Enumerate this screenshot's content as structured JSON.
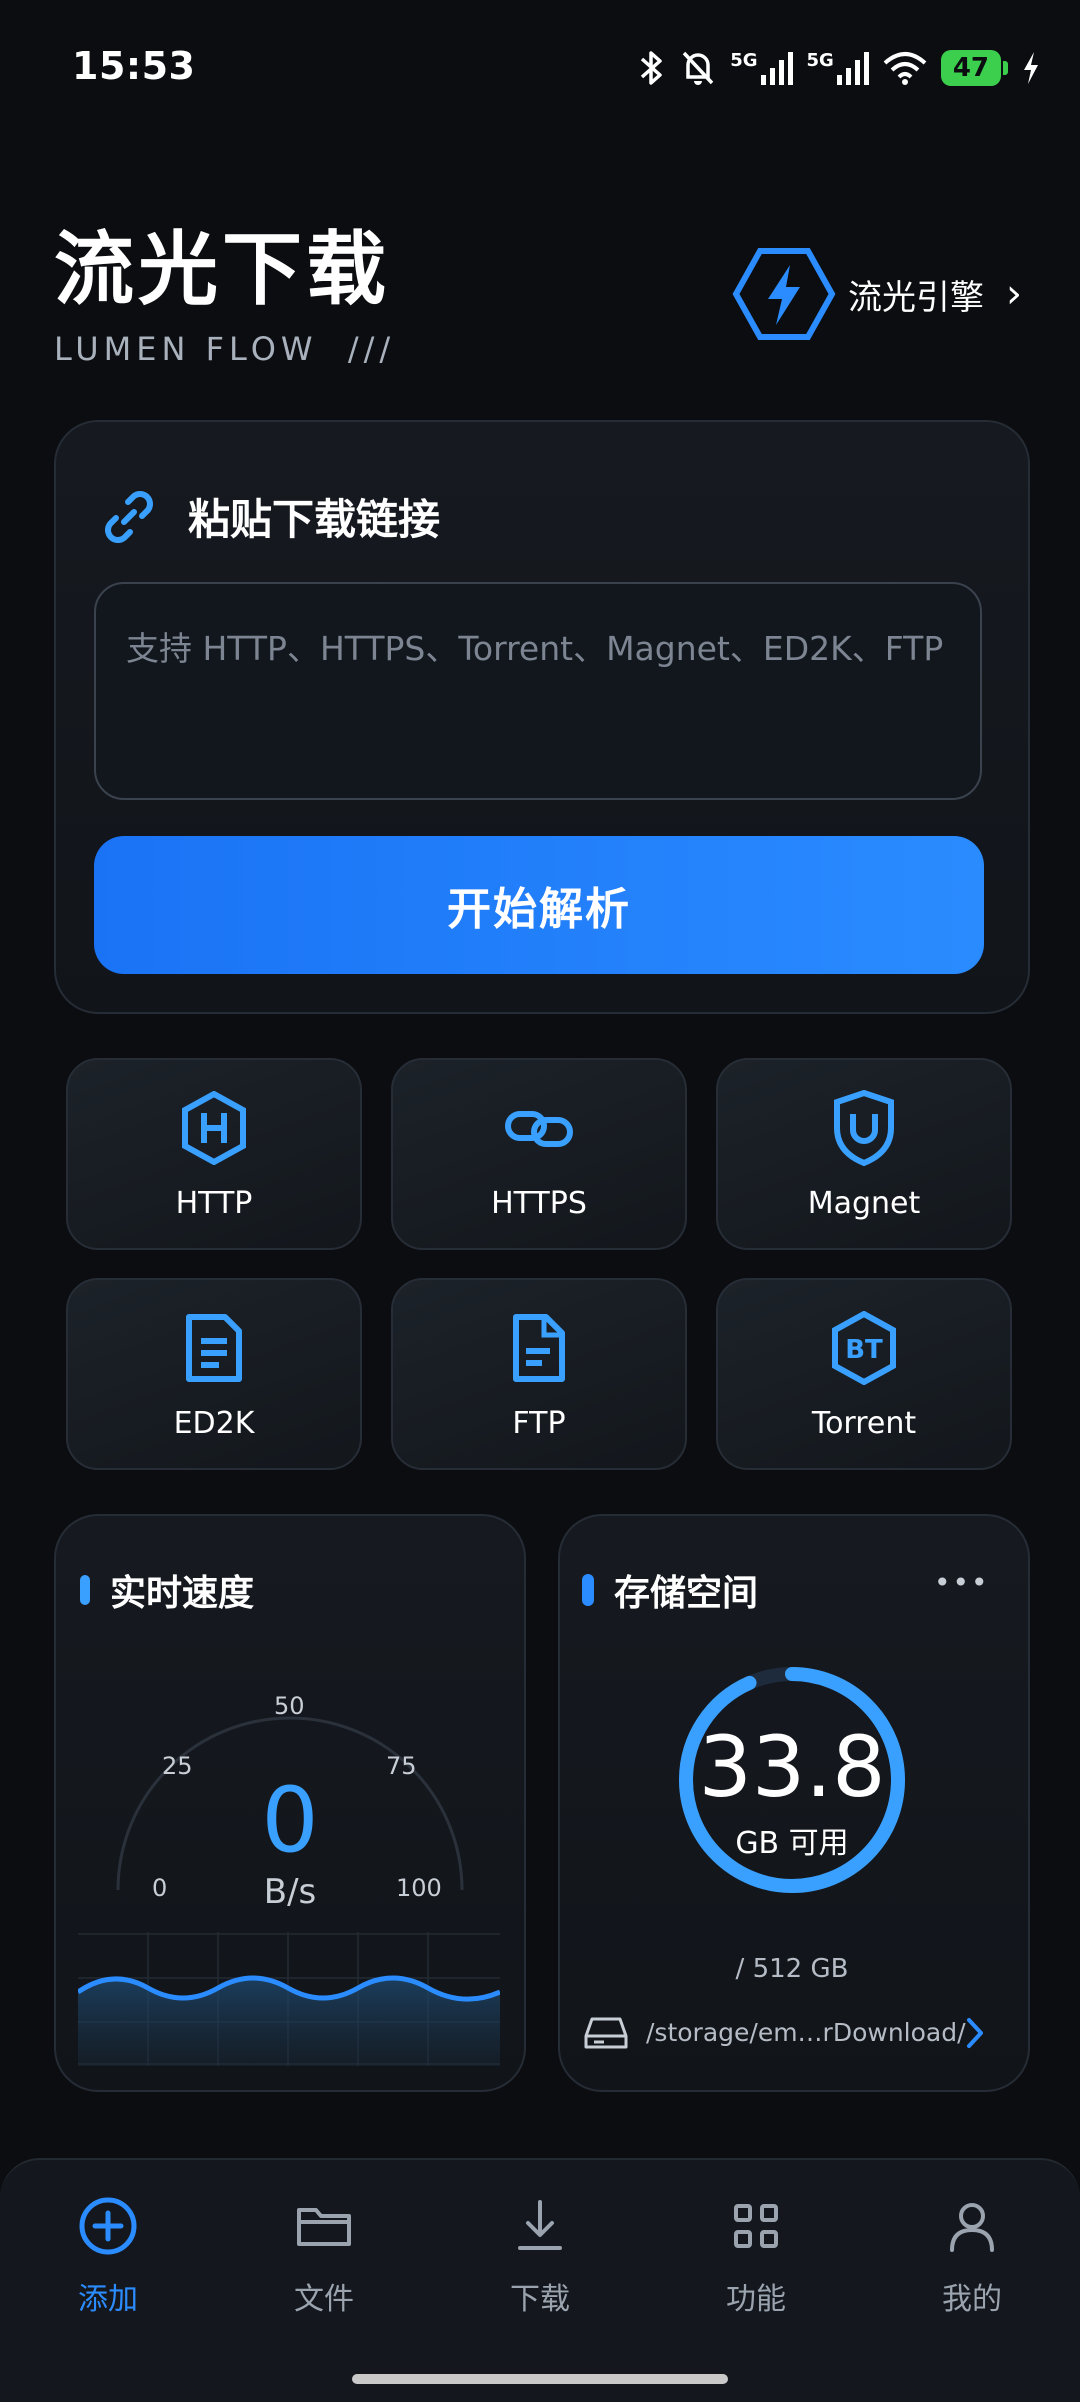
{
  "status_bar": {
    "time": "15:53",
    "network_1": "5G",
    "network_2": "5G",
    "battery": "47",
    "icons": [
      "bluetooth-icon",
      "bell-muted-icon",
      "signal-icon",
      "signal-icon",
      "wifi-icon",
      "battery-icon",
      "charging-icon"
    ]
  },
  "header": {
    "title": "流光下载",
    "subtitle": "LUMEN FLOW  ///",
    "engine_label": "流光引擎",
    "engine_chevron": "›",
    "accent": "#2b8cff"
  },
  "paste_card": {
    "title": "粘贴下载链接",
    "input_placeholder": "支持 HTTP、HTTPS、Torrent、Magnet、ED2K、FTP",
    "button_label": "开始解析"
  },
  "protocols": [
    {
      "label": "HTTP",
      "icon": "http-hexagon-icon"
    },
    {
      "label": "HTTPS",
      "icon": "link-chain-icon"
    },
    {
      "label": "Magnet",
      "icon": "magnet-shield-icon"
    },
    {
      "label": "ED2K",
      "icon": "document-icon"
    },
    {
      "label": "FTP",
      "icon": "file-icon"
    },
    {
      "label": "Torrent",
      "icon": "bt-hexagon-icon"
    }
  ],
  "speed_card": {
    "title": "实时速度",
    "value": "0",
    "unit": "B/s",
    "ticks": [
      "0",
      "25",
      "50",
      "75",
      "100"
    ]
  },
  "storage_card": {
    "title": "存储空间",
    "more": "•••",
    "available": "33.8",
    "available_label": "GB 可用",
    "total": "/ 512 GB",
    "path": "/storage/em…rDownload/",
    "used_fraction": 0.934
  },
  "bottom_nav": [
    {
      "label": "添加",
      "icon": "plus-circle-icon",
      "active": true
    },
    {
      "label": "文件",
      "icon": "folder-icon",
      "active": false
    },
    {
      "label": "下载",
      "icon": "download-icon",
      "active": false
    },
    {
      "label": "功能",
      "icon": "grid-icon",
      "active": false
    },
    {
      "label": "我的",
      "icon": "person-icon",
      "active": false
    }
  ]
}
